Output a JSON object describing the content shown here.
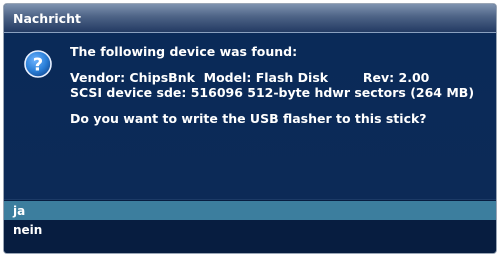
{
  "dialog": {
    "title": "Nachricht",
    "icon": "question-icon",
    "message": {
      "line1": "The following device was found:",
      "vendor": "Vendor: ChipsBnk",
      "model": "Model: Flash Disk",
      "rev": "Rev: 2.00",
      "scsi": "SCSI device sde: 516096 512-byte hdwr sectors (264 MB)",
      "question": "Do you want to write the USB flasher to this stick?"
    },
    "options": [
      {
        "label": "ja",
        "selected": true
      },
      {
        "label": "nein",
        "selected": false
      }
    ],
    "colors": {
      "background": "#0a2650",
      "selection": "#3c7e9e",
      "icon": "#2a7fd8"
    }
  }
}
